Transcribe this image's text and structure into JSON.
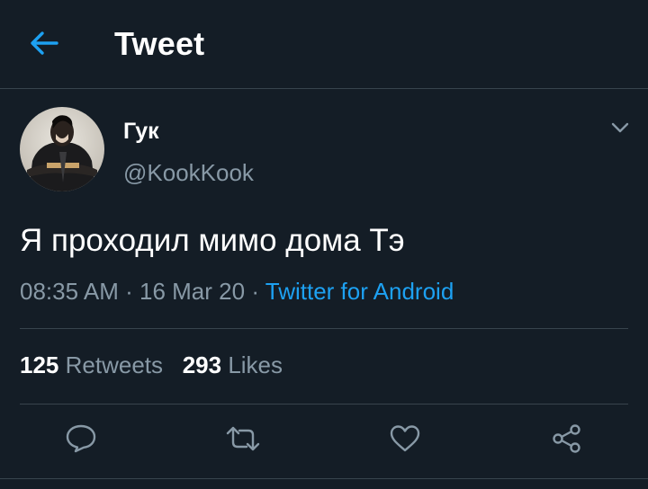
{
  "header": {
    "title": "Tweet",
    "back_icon": "arrow-left-icon",
    "accent_color": "#1da1f2"
  },
  "tweet": {
    "display_name": "Гук",
    "handle": "@KookKook",
    "text": "Я проходил мимо дома Тэ",
    "time": "08:35 AM",
    "separator": "·",
    "date": "16 Mar 20",
    "source": "Twitter for Android",
    "more_icon": "chevron-down-icon"
  },
  "stats": {
    "retweets_count": "125",
    "retweets_label": "Retweets",
    "likes_count": "293",
    "likes_label": "Likes"
  },
  "actions": {
    "reply_icon": "reply-icon",
    "retweet_icon": "retweet-icon",
    "like_icon": "heart-icon",
    "share_icon": "share-icon"
  },
  "colors": {
    "background": "#141d26",
    "secondary_text": "#8899a6",
    "divider": "#38444d"
  }
}
